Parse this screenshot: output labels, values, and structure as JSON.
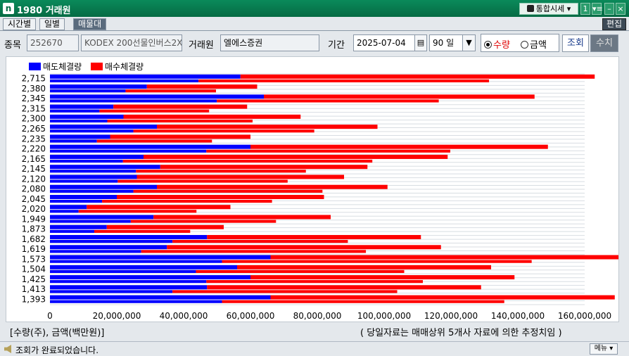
{
  "window": {
    "title": "1980 거래원",
    "icon": "n",
    "combo_label": "통합시세",
    "combo_arrow": "▾",
    "btn_one": "1",
    "btn_menu": "▾≡",
    "btn_min": "–",
    "btn_close": "×"
  },
  "tabs": [
    {
      "label": "시간별"
    },
    {
      "label": "일별"
    },
    {
      "label": "매물대"
    }
  ],
  "edit_label": "편집",
  "filter": {
    "stock_label": "종목",
    "stock_code": "252670",
    "stock_name": "KODEX 200선물인버스2X",
    "broker_label": "거래원",
    "broker_name": "엘에스증권",
    "period_label": "기간",
    "date": "2025-07-04",
    "days": "90 일",
    "radio_qty": "수량",
    "radio_amt": "금액",
    "query_btn": "조회",
    "num_btn": "수치"
  },
  "chart_data": {
    "type": "bar",
    "orientation": "horizontal",
    "stacked": true,
    "legend": [
      {
        "name": "매도체결량",
        "color": "#0000ff"
      },
      {
        "name": "매수체결량",
        "color": "#ff0000"
      }
    ],
    "legend_position": "top-left",
    "categories": [
      "2,715",
      "2,380",
      "2,345",
      "2,315",
      "2,300",
      "2,265",
      "2,235",
      "2,220",
      "2,165",
      "2,145",
      "2,120",
      "2,080",
      "2,045",
      "2,020",
      "1,949",
      "1,873",
      "1,682",
      "1,619",
      "1,573",
      "1,504",
      "1,425",
      "1,413",
      "1,393"
    ],
    "series": [
      {
        "name": "매도체결량",
        "color": "#0000ff",
        "values": [
          57000000,
          29000000,
          64000000,
          19000000,
          22000000,
          32000000,
          18000000,
          60000000,
          28000000,
          33000000,
          26000000,
          32000000,
          20000000,
          11000000,
          31000000,
          17000000,
          47000000,
          35000000,
          66000000,
          56000000,
          60000000,
          47000000,
          66000000
        ]
      },
      {
        "name": "매수체결량",
        "color": "#ff0000",
        "values": [
          106000000,
          33000000,
          81000000,
          40000000,
          53000000,
          66000000,
          42000000,
          89000000,
          91000000,
          62000000,
          62000000,
          69000000,
          62000000,
          43000000,
          53000000,
          35000000,
          64000000,
          82000000,
          113000000,
          76000000,
          79000000,
          82000000,
          103000000
        ]
      }
    ],
    "xticks": [
      "0",
      "20,000,000",
      "40,000,000",
      "60,000,000",
      "80,000,000",
      "100,000,000",
      "120,000,000",
      "140,000,000",
      "160,000,000"
    ],
    "xlim": [
      0,
      160000000
    ],
    "grid": true
  },
  "footer_left": "[수량(주), 금액(백만원)]",
  "footer_right": "( 당일자료는 매매상위 5개사 자료에 의한 추정치임 )",
  "status_text": "조회가 완료되었습니다.",
  "menu_btn": "메뉴 ▾"
}
